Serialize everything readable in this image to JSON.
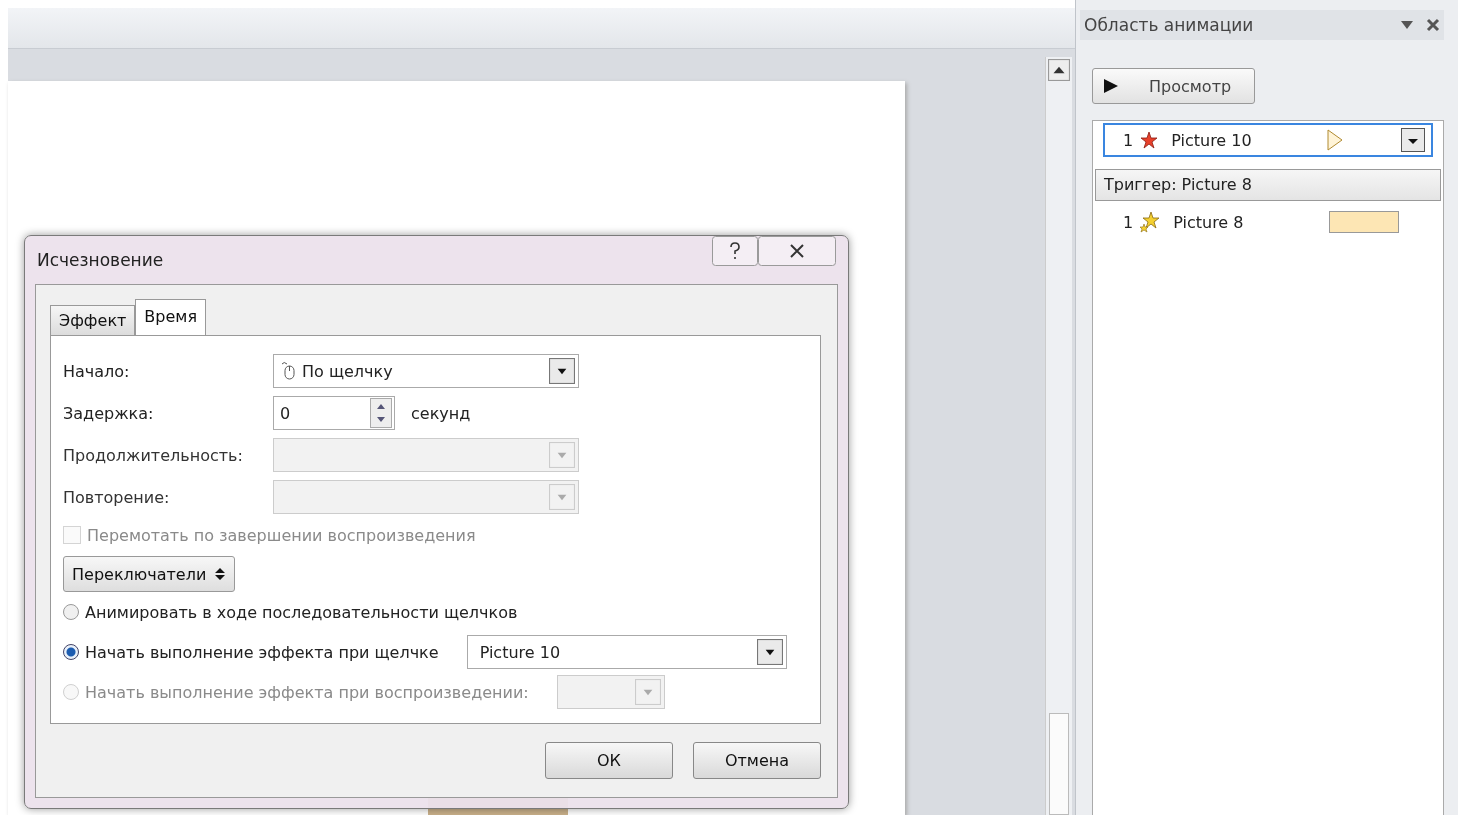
{
  "animation_pane": {
    "title": "Область анимации",
    "play_button": "Просмотр",
    "items": [
      {
        "number": "1",
        "name": "Picture 10",
        "kind": "trigger-marker",
        "selected": true
      }
    ],
    "trigger": {
      "label": "Триггер: Picture 8",
      "items": [
        {
          "number": "1",
          "name": "Picture 8",
          "kind": "timeline-bar",
          "selected": false
        }
      ]
    }
  },
  "dialog": {
    "title": "Исчезновение",
    "tabs": [
      {
        "label": "Эффект",
        "selected": false
      },
      {
        "label": "Время",
        "selected": true
      }
    ],
    "fields": [
      {
        "label": "Начало:",
        "kind": "dropdown",
        "value": "По щелчку",
        "disabled": false
      },
      {
        "label": "Задержка:",
        "kind": "spinner",
        "value": "0",
        "unit": "секунд"
      },
      {
        "label": "Продолжительность:",
        "kind": "dropdown",
        "disabled": true
      },
      {
        "label": "Повторение:",
        "kind": "dropdown",
        "disabled": true
      }
    ],
    "rewind": {
      "label": "Перемотать по завершении воспроизведения",
      "checked": false,
      "disabled": true
    },
    "triggers_button": "Переключатели",
    "trigger_options": [
      {
        "label": "Анимировать в ходе последовательности щелчков",
        "selected": false,
        "disabled": false
      },
      {
        "label": "Начать выполнение эффекта при щелчке",
        "selected": true,
        "disabled": false,
        "kind": "wide-dropdown",
        "value": "Picture 10"
      },
      {
        "label": "Начать выполнение эффекта при воспроизведении:",
        "selected": false,
        "disabled": true,
        "kind": "small-dropdown"
      }
    ],
    "buttons": [
      "ОК",
      "Отмена"
    ]
  }
}
